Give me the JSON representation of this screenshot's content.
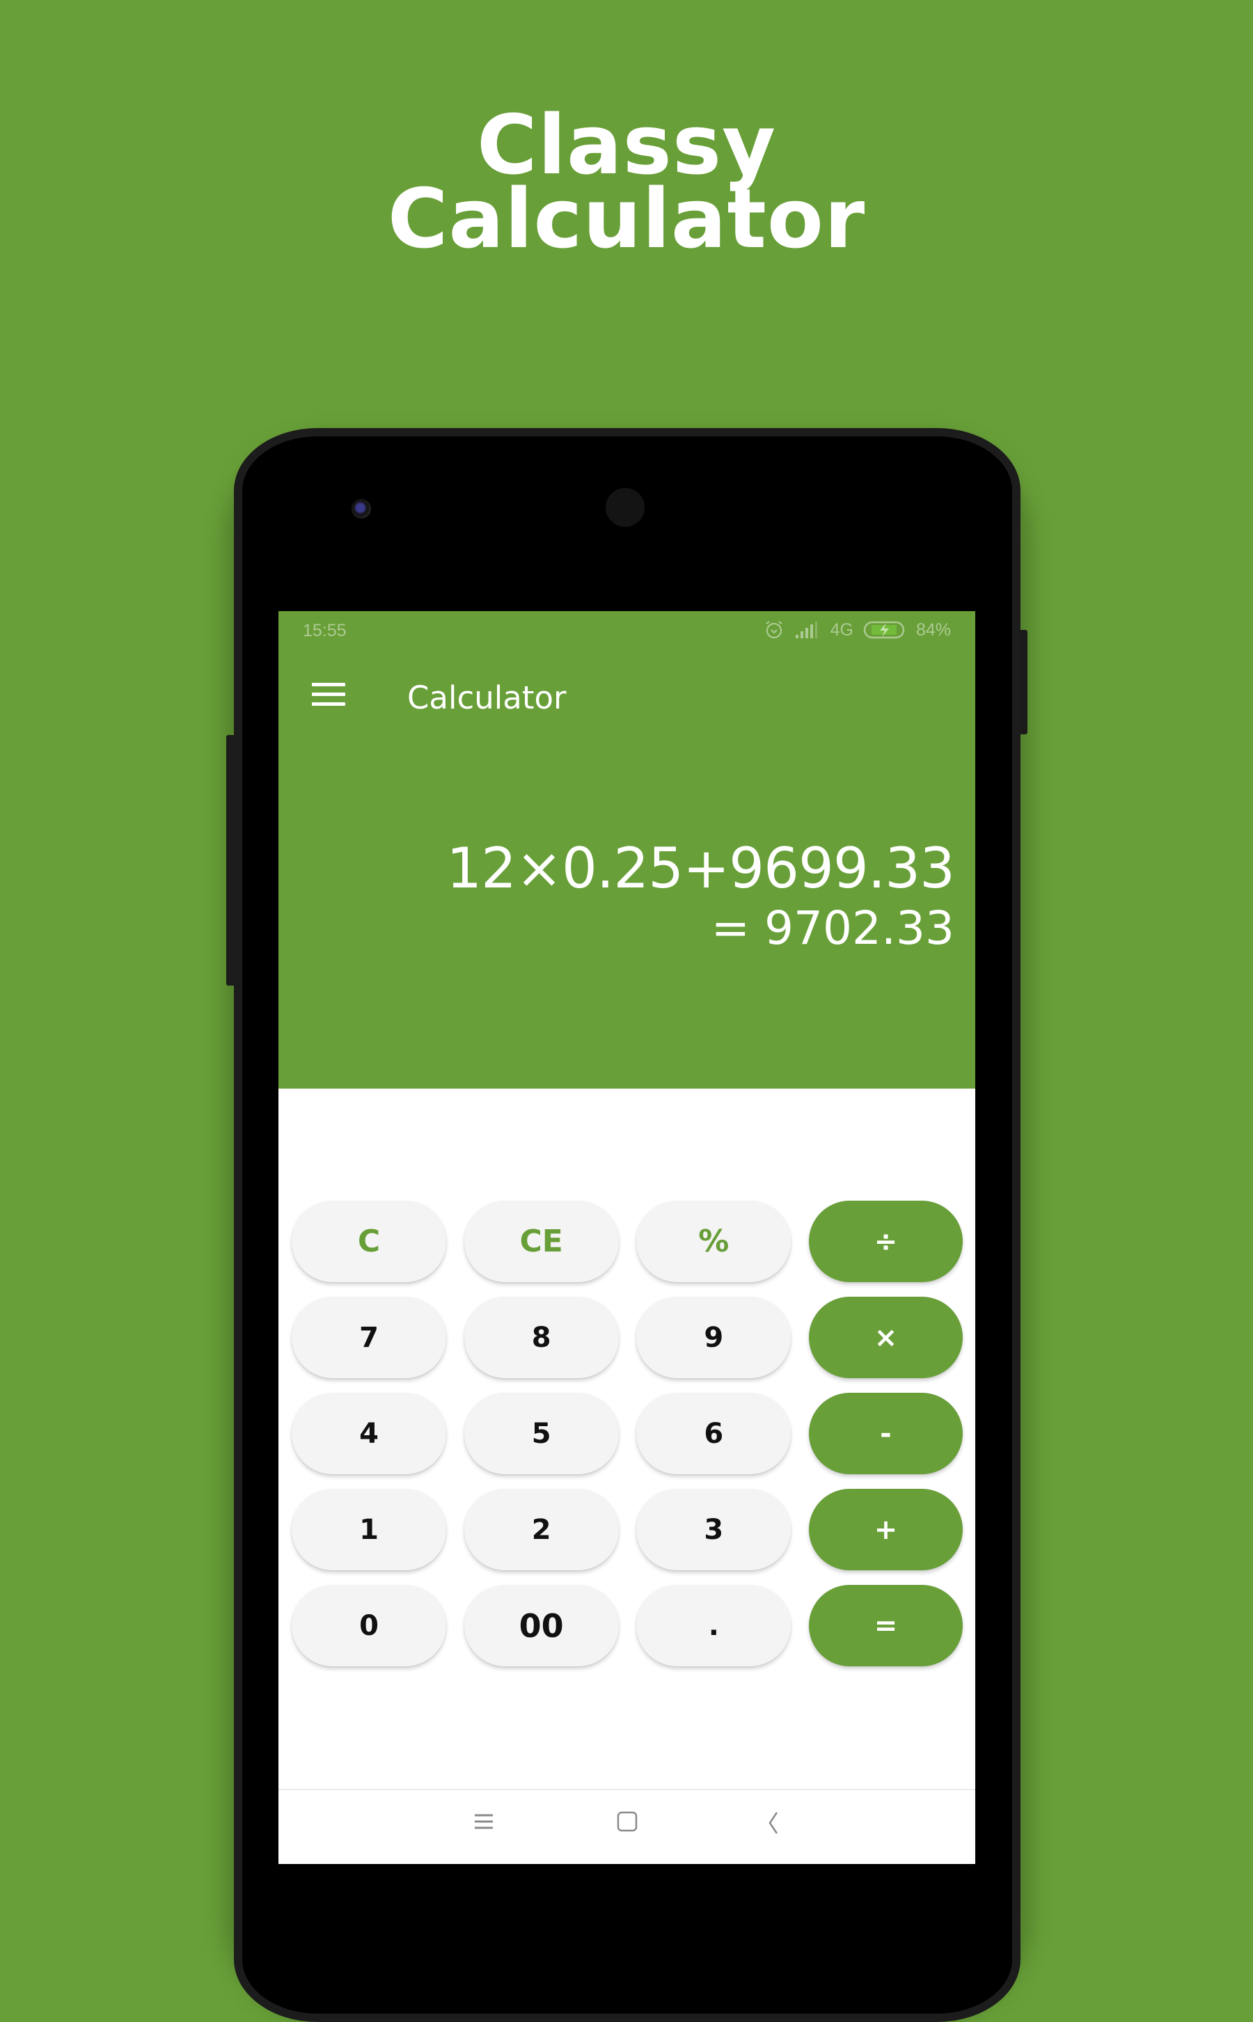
{
  "promo": {
    "title_line1": "Classy",
    "title_line2": "Calculator",
    "background_color": "#689f38"
  },
  "status_bar": {
    "time": "15:55",
    "icons": [
      "alarm-icon",
      "signal-icon",
      "network-4g-icon",
      "battery-charging-icon"
    ],
    "network": "4G",
    "battery": "84%"
  },
  "app": {
    "title": "Calculator",
    "menu_icon": "hamburger-menu-icon",
    "accent_color": "#689f38"
  },
  "display": {
    "expression": "12×0.25+9699.33",
    "result": "= 9702.33"
  },
  "keypad": {
    "rows": [
      [
        {
          "label": "C",
          "type": "function",
          "name": "clear"
        },
        {
          "label": "CE",
          "type": "function",
          "name": "clear-entry"
        },
        {
          "label": "%",
          "type": "function",
          "name": "percent"
        },
        {
          "label": "÷",
          "type": "operator",
          "name": "divide"
        }
      ],
      [
        {
          "label": "7",
          "type": "digit",
          "name": "7"
        },
        {
          "label": "8",
          "type": "digit",
          "name": "8"
        },
        {
          "label": "9",
          "type": "digit",
          "name": "9"
        },
        {
          "label": "×",
          "type": "operator",
          "name": "multiply"
        }
      ],
      [
        {
          "label": "4",
          "type": "digit",
          "name": "4"
        },
        {
          "label": "5",
          "type": "digit",
          "name": "5"
        },
        {
          "label": "6",
          "type": "digit",
          "name": "6"
        },
        {
          "label": "-",
          "type": "operator",
          "name": "subtract"
        }
      ],
      [
        {
          "label": "1",
          "type": "digit",
          "name": "1"
        },
        {
          "label": "2",
          "type": "digit",
          "name": "2"
        },
        {
          "label": "3",
          "type": "digit",
          "name": "3"
        },
        {
          "label": "+",
          "type": "operator",
          "name": "add"
        }
      ],
      [
        {
          "label": "0",
          "type": "digit",
          "name": "0"
        },
        {
          "label": "00",
          "type": "digit",
          "name": "double-zero"
        },
        {
          "label": ".",
          "type": "digit",
          "name": "decimal-point"
        },
        {
          "label": "=",
          "type": "operator",
          "name": "equals"
        }
      ]
    ]
  },
  "nav_bar": {
    "buttons": [
      {
        "name": "recents",
        "icon": "recents-menu-icon"
      },
      {
        "name": "home",
        "icon": "home-square-icon"
      },
      {
        "name": "back",
        "icon": "back-chevron-icon"
      }
    ]
  }
}
